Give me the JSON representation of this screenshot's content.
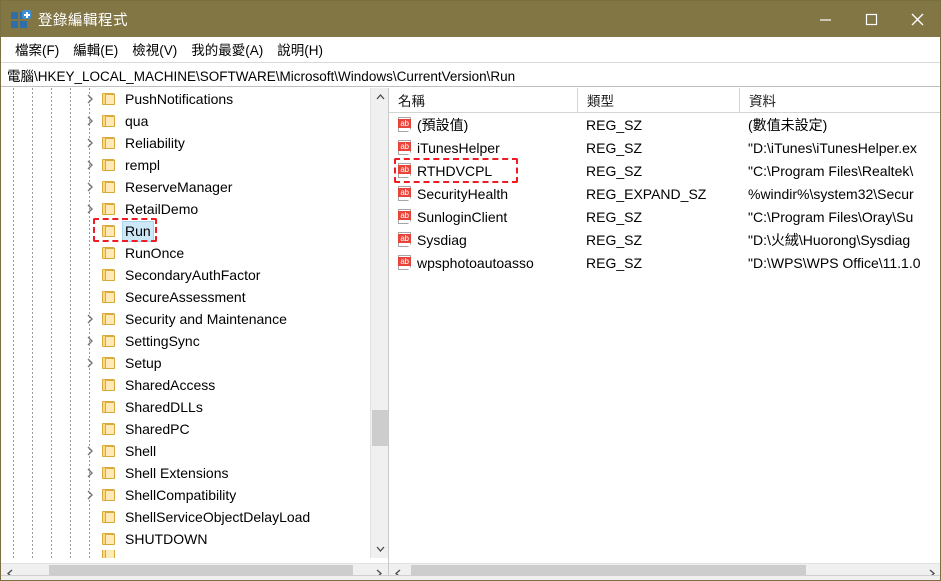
{
  "window": {
    "title": "登錄編輯程式",
    "icon": "registry-editor-icon",
    "titlebar_color": "#837645",
    "controls": {
      "minimize": "最小化",
      "maximize": "最大化",
      "close": "關閉"
    }
  },
  "menubar": {
    "items": [
      {
        "label": "檔案(F)"
      },
      {
        "label": "編輯(E)"
      },
      {
        "label": "檢視(V)"
      },
      {
        "label": "我的最愛(A)"
      },
      {
        "label": "說明(H)"
      }
    ]
  },
  "address": {
    "path": "電腦\\HKEY_LOCAL_MACHINE\\SOFTWARE\\Microsoft\\Windows\\CurrentVersion\\Run"
  },
  "tree": {
    "items": [
      {
        "label": "PushNotifications",
        "indent": 5,
        "expander": true,
        "selected": false
      },
      {
        "label": "qua",
        "indent": 5,
        "expander": true,
        "selected": false
      },
      {
        "label": "Reliability",
        "indent": 5,
        "expander": true,
        "selected": false
      },
      {
        "label": "rempl",
        "indent": 5,
        "expander": true,
        "selected": false
      },
      {
        "label": "ReserveManager",
        "indent": 5,
        "expander": true,
        "selected": false
      },
      {
        "label": "RetailDemo",
        "indent": 5,
        "expander": true,
        "selected": false
      },
      {
        "label": "Run",
        "indent": 5,
        "expander": false,
        "selected": true
      },
      {
        "label": "RunOnce",
        "indent": 5,
        "expander": false,
        "selected": false
      },
      {
        "label": "SecondaryAuthFactor",
        "indent": 5,
        "expander": false,
        "selected": false
      },
      {
        "label": "SecureAssessment",
        "indent": 5,
        "expander": false,
        "selected": false
      },
      {
        "label": "Security and Maintenance",
        "indent": 5,
        "expander": true,
        "selected": false
      },
      {
        "label": "SettingSync",
        "indent": 5,
        "expander": true,
        "selected": false
      },
      {
        "label": "Setup",
        "indent": 5,
        "expander": true,
        "selected": false
      },
      {
        "label": "SharedAccess",
        "indent": 5,
        "expander": false,
        "selected": false
      },
      {
        "label": "SharedDLLs",
        "indent": 5,
        "expander": false,
        "selected": false
      },
      {
        "label": "SharedPC",
        "indent": 5,
        "expander": false,
        "selected": false
      },
      {
        "label": "Shell",
        "indent": 5,
        "expander": true,
        "selected": false
      },
      {
        "label": "Shell Extensions",
        "indent": 5,
        "expander": true,
        "selected": false
      },
      {
        "label": "ShellCompatibility",
        "indent": 5,
        "expander": true,
        "selected": false
      },
      {
        "label": "ShellServiceObjectDelayLoad",
        "indent": 5,
        "expander": false,
        "selected": false
      },
      {
        "label": "SHUTDOWN",
        "indent": 5,
        "expander": false,
        "selected": false
      }
    ],
    "selected_label": "Run",
    "annotation_color": "#ee1c25"
  },
  "list": {
    "columns": [
      {
        "label": "名稱"
      },
      {
        "label": "類型"
      },
      {
        "label": "資料"
      }
    ],
    "rows": [
      {
        "name": "(預設值)",
        "type": "REG_SZ",
        "data": "(數值未設定)",
        "icon": "string-value-icon",
        "annotated": false
      },
      {
        "name": "iTunesHelper",
        "type": "REG_SZ",
        "data": "\"D:\\iTunes\\iTunesHelper.ex",
        "icon": "string-value-icon",
        "annotated": false
      },
      {
        "name": "RTHDVCPL",
        "type": "REG_SZ",
        "data": "\"C:\\Program Files\\Realtek\\",
        "icon": "string-value-icon",
        "annotated": true
      },
      {
        "name": "SecurityHealth",
        "type": "REG_EXPAND_SZ",
        "data": "%windir%\\system32\\Secur",
        "icon": "string-value-icon",
        "annotated": false
      },
      {
        "name": "SunloginClient",
        "type": "REG_SZ",
        "data": "\"C:\\Program Files\\Oray\\Su",
        "icon": "string-value-icon",
        "annotated": false
      },
      {
        "name": "Sysdiag",
        "type": "REG_SZ",
        "data": "\"D:\\火絨\\Huorong\\Sysdiag",
        "icon": "string-value-icon",
        "annotated": false
      },
      {
        "name": "wpsphotoautoasso",
        "type": "REG_SZ",
        "data": "\"D:\\WPS\\WPS Office\\11.1.0",
        "icon": "string-value-icon",
        "annotated": false
      }
    ],
    "value_icon_text": "ab"
  },
  "scrollbars": {
    "tree_vertical": {
      "up": "向上捲動",
      "down": "向下捲動"
    },
    "tree_horizontal": {
      "left": "向左捲動",
      "right": "向右捲動"
    },
    "list_horizontal": {
      "left": "向左捲動",
      "right": "向右捲動"
    }
  }
}
